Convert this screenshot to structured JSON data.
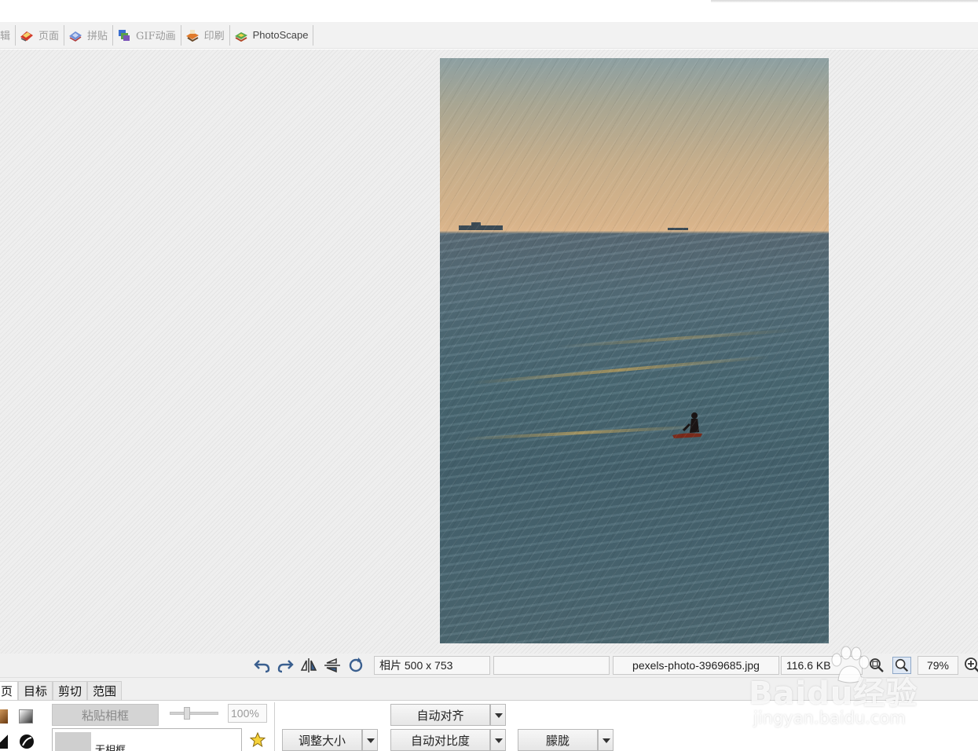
{
  "module_tabs": [
    {
      "label": "辑",
      "active": false
    },
    {
      "label": "页面",
      "active": false
    },
    {
      "label": "拼贴",
      "active": false
    },
    {
      "label": "GIF动画",
      "active": false
    },
    {
      "label": "印刷",
      "active": false
    },
    {
      "label": "PhotoScape",
      "active": false
    }
  ],
  "status": {
    "photo_size": "相片 500 x 753",
    "empty_field": "",
    "filename": "pexels-photo-3969685.jpg",
    "filesize": "116.6 KB",
    "zoom": "79%"
  },
  "editor_tabs": [
    {
      "label": "页",
      "active": true
    },
    {
      "label": "目标",
      "active": false
    },
    {
      "label": "剪切",
      "active": false
    },
    {
      "label": "范围",
      "active": false
    }
  ],
  "editor": {
    "paste_frame": "粘贴相框",
    "opacity": "100%",
    "opacity_level": 0.3,
    "frame_name": "无相框",
    "resize": "调整大小",
    "auto_level": "自动对齐",
    "auto_contrast": "自动对比度",
    "blur": "朦胧"
  },
  "watermark": {
    "logo": "Baidu经验",
    "url": "jingyan.baidu.com"
  },
  "colors": {
    "tabbar_bg": "#f2f2f2",
    "canvas_bg": "#ebebeb",
    "panel_bg": "#f0f0f0"
  }
}
